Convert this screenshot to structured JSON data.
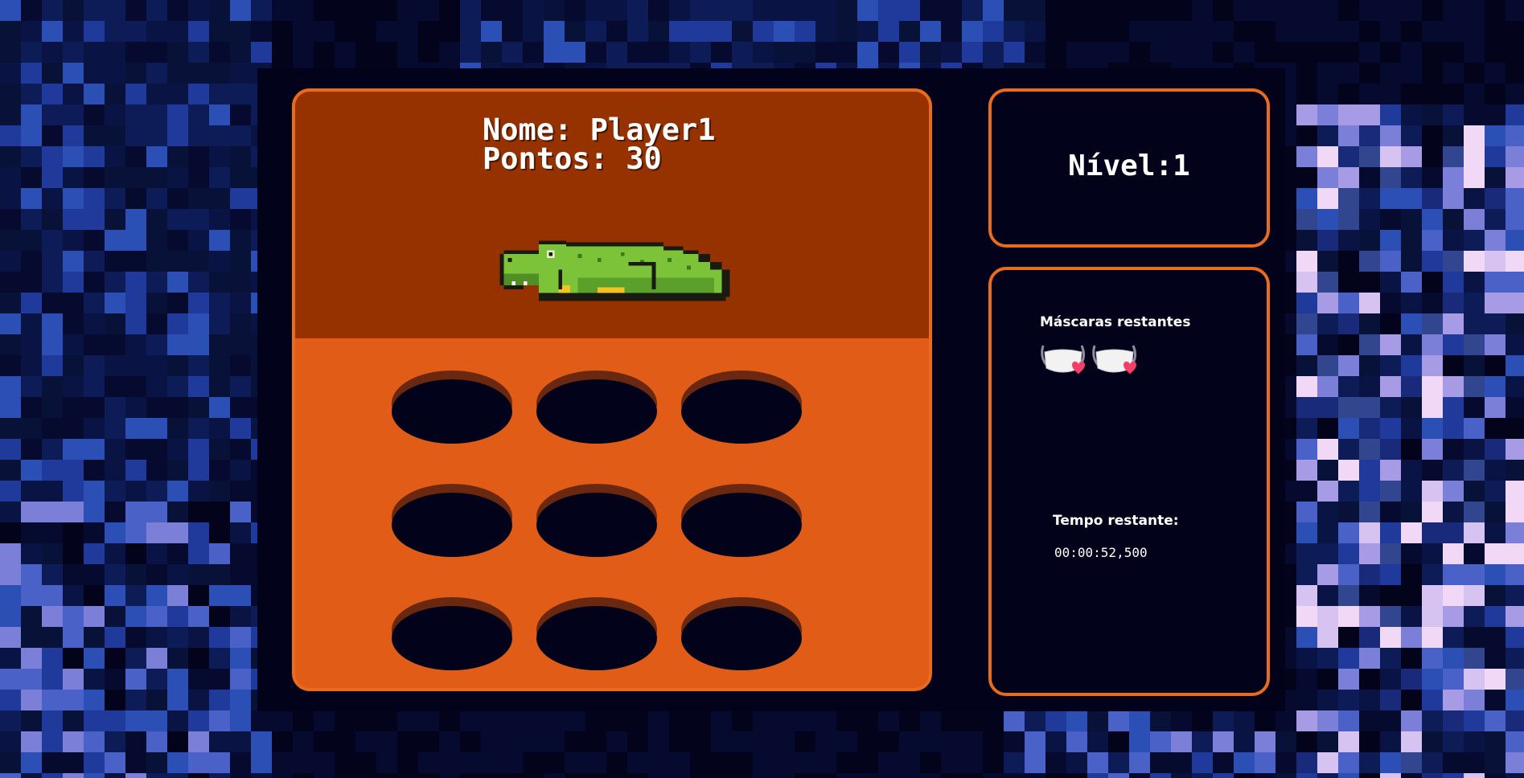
{
  "player": {
    "name_line": "Nome: Player1",
    "score_line": "Pontos: 30"
  },
  "level": {
    "text": "Nível:1"
  },
  "masks": {
    "label": "Máscaras restantes",
    "remaining": 2,
    "icon": "mask-heart-icon"
  },
  "timer": {
    "label": "Tempo restante:",
    "value": "00:00:52,500"
  },
  "holes": {
    "count": 9,
    "rows": 3,
    "cols": 3
  },
  "colors": {
    "panel_border": "#ea6a1e",
    "top_area": "#963100",
    "game_field": "#e05c17",
    "hole": "#02031a",
    "hole_rim": "#6a2810",
    "background": "#03041c",
    "heart": "#f43f66"
  }
}
